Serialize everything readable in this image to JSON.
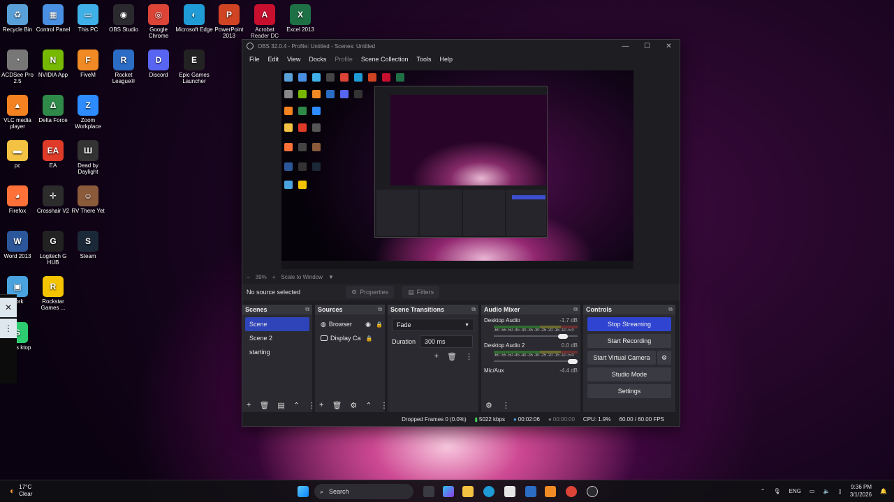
{
  "desktop": {
    "icons": [
      {
        "label": "Recycle Bin",
        "color": "#5aa0d8",
        "glyph": "♻"
      },
      {
        "label": "Control Panel",
        "color": "#4a90e2",
        "glyph": "▦"
      },
      {
        "label": "This PC",
        "color": "#3fb0e8",
        "glyph": "▭"
      },
      {
        "label": "OBS Studio",
        "color": "#2a2a2e",
        "glyph": "◉"
      },
      {
        "label": "Google Chrome",
        "color": "#db4437",
        "glyph": "◎"
      },
      {
        "label": "Microsoft Edge",
        "color": "#1f9bd6",
        "glyph": "◐"
      },
      {
        "label": "PowerPoint 2013",
        "color": "#d04423",
        "glyph": "P"
      },
      {
        "label": "Acrobat Reader DC",
        "color": "#c8102e",
        "glyph": "A"
      },
      {
        "label": "Excel 2013",
        "color": "#1e7145",
        "glyph": "X"
      },
      {
        "label": "ACDSee Pro 2.5",
        "color": "#777777",
        "glyph": "◔"
      },
      {
        "label": "NVIDIA App",
        "color": "#76b900",
        "glyph": "N"
      },
      {
        "label": "FiveM",
        "color": "#f08a24",
        "glyph": "F"
      },
      {
        "label": "Rocket League®",
        "color": "#2b6cc4",
        "glyph": "R"
      },
      {
        "label": "Discord",
        "color": "#5865f2",
        "glyph": "D"
      },
      {
        "label": "Epic Games Launcher",
        "color": "#222222",
        "glyph": "E"
      },
      {
        "label": "VLC media player",
        "color": "#f58220",
        "glyph": "▲"
      },
      {
        "label": "Delta Force",
        "color": "#2f8a4a",
        "glyph": "Δ"
      },
      {
        "label": "Zoom Workplace",
        "color": "#2d8cff",
        "glyph": "Z"
      },
      {
        "label": "pc",
        "color": "#f3c242",
        "glyph": "▬"
      },
      {
        "label": "EA",
        "color": "#e03a28",
        "glyph": "EA"
      },
      {
        "label": "Dead by Daylight",
        "color": "#333333",
        "glyph": "Ш"
      },
      {
        "label": "Firefox",
        "color": "#ff7139",
        "glyph": "◕"
      },
      {
        "label": "Crosshair V2",
        "color": "#2c2c2c",
        "glyph": "✛"
      },
      {
        "label": "RV There Yet",
        "color": "#8a5a3a",
        "glyph": "☺"
      },
      {
        "label": "Word 2013",
        "color": "#2b579a",
        "glyph": "W"
      },
      {
        "label": "Logitech G HUB",
        "color": "#222222",
        "glyph": "G"
      },
      {
        "label": "Steam",
        "color": "#1b2838",
        "glyph": "S"
      },
      {
        "label": "work",
        "color": "#4aa3df",
        "glyph": "▣"
      },
      {
        "label": "Rockstar Games ...",
        "color": "#f4c400",
        "glyph": "R"
      },
      {
        "label": "mlabs ktop",
        "color": "#2ecc71",
        "glyph": "S"
      }
    ]
  },
  "obs": {
    "title": "OBS 32.0.4 - Profile: Untitled - Scenes: Untitled",
    "menu": [
      "File",
      "Edit",
      "View",
      "Docks",
      "Profile",
      "Scene Collection",
      "Tools",
      "Help"
    ],
    "zoom": {
      "minus": "−",
      "value": "39%",
      "plus": "+",
      "mode": "Scale to Window"
    },
    "no_source": "No source selected",
    "properties": "Properties",
    "filters": "Filters",
    "scenes": {
      "title": "Scenes",
      "items": [
        "Scene",
        "Scene 2",
        "starting"
      ]
    },
    "sources": {
      "title": "Sources",
      "items": [
        "Browser",
        "Display Ca"
      ]
    },
    "transitions": {
      "title": "Scene Transitions",
      "selected": "Fade",
      "duration_label": "Duration",
      "duration_value": "300 ms"
    },
    "mixer": {
      "title": "Audio Mixer",
      "channels": [
        {
          "name": "Desktop Audio",
          "db": "-1.7 dB",
          "ticks": "-60 -55 -50 -45 -40 -35 -30 -25 -20 -15 -10 -5 0",
          "level": 0.88
        },
        {
          "name": "Desktop Audio 2",
          "db": "0.0 dB",
          "ticks": "-60 -55 -50 -45 -40 -35 -30 -25 -20 -15 -10 -5 0",
          "level": 1.0
        },
        {
          "name": "Mic/Aux",
          "db": "-4.4 dB"
        }
      ]
    },
    "controls": {
      "title": "Controls",
      "stop_streaming": "Stop Streaming",
      "start_recording": "Start Recording",
      "start_virtual_camera": "Start Virtual Camera",
      "studio_mode": "Studio Mode",
      "settings": "Settings"
    },
    "status": {
      "dropped": "Dropped Frames 0 (0.0%)",
      "bitrate": "5022 kbps",
      "stream_time": "00:02:06",
      "rec_time": "00:00:00",
      "cpu": "CPU: 1.9%",
      "fps": "60.00 / 60.00 FPS"
    }
  },
  "taskbar": {
    "weather_temp": "17°C",
    "weather_desc": "Clear",
    "search": "Search",
    "lang": "ENG",
    "time": "9:36 PM",
    "date": "3/1/2026"
  }
}
